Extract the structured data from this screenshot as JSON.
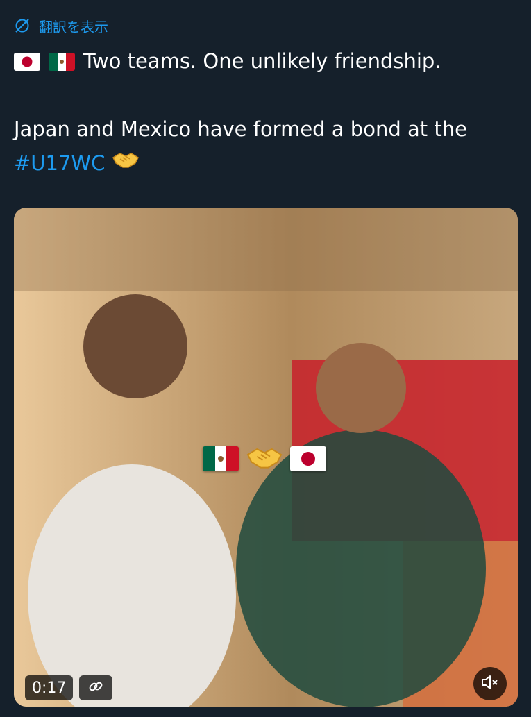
{
  "translate": {
    "label": "翻訳を表示",
    "icon": "globe-slash-icon"
  },
  "tweet": {
    "line1": "Two teams. One unlikely friendship.",
    "line1_emojis": [
      "japan-flag",
      "mexico-flag"
    ],
    "line2": "Japan and Mexico have formed a bond at the",
    "hashtag": "#U17WC",
    "hashtag_emoji": "handshake-emoji"
  },
  "media": {
    "type": "video",
    "overlay_emojis": [
      "mexico-flag",
      "handshake-emoji",
      "japan-flag"
    ],
    "time": "0:17",
    "link_icon": "link-icon",
    "mute_icon": "speaker-muted-icon"
  },
  "colors": {
    "background": "#15202b",
    "accent": "#1d9bf0",
    "text": "#ffffff",
    "mexico_green": "#006847",
    "mexico_red": "#ce1126",
    "japan_red": "#bc002d"
  }
}
